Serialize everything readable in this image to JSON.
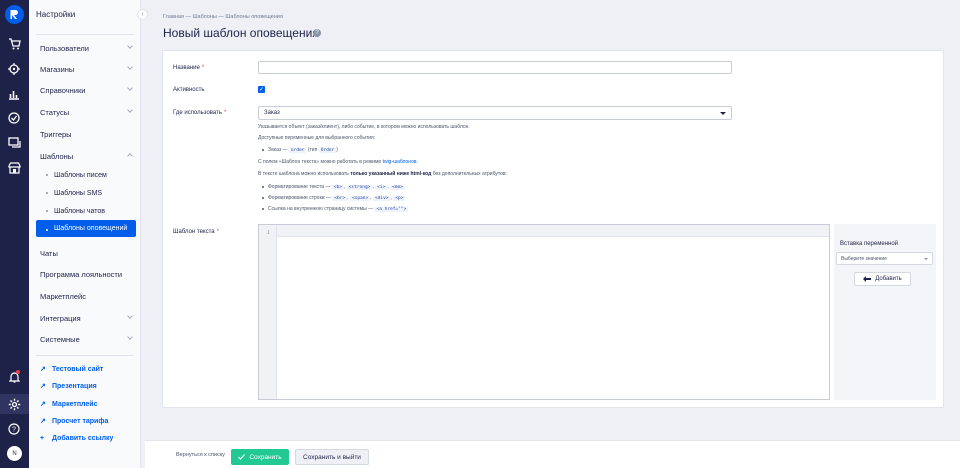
{
  "app": {
    "logo": "retailcrm-logo",
    "rail_icons": [
      "cart-icon",
      "target-icon",
      "analytics-icon",
      "tasks-icon",
      "chat-icon",
      "store-icon",
      "bell-icon",
      "gear-icon",
      "help-icon"
    ],
    "avatar_initial": "N",
    "accent": "#005eeb"
  },
  "sidebar": {
    "title": "Настройки",
    "items": [
      {
        "label": "Пользователи",
        "chevron": true
      },
      {
        "label": "Магазины",
        "chevron": true
      },
      {
        "label": "Справочники",
        "chevron": true
      },
      {
        "label": "Статусы",
        "chevron": true
      },
      {
        "label": "Триггеры",
        "chevron": false
      },
      {
        "label": "Шаблоны",
        "chevron": true,
        "expanded": true
      },
      {
        "label": "Шаблоны писем",
        "sub": true
      },
      {
        "label": "Шаблоны SMS",
        "sub": true
      },
      {
        "label": "Шаблоны чатов",
        "sub": true
      },
      {
        "label": "Шаблоны оповещений",
        "sub": true,
        "active": true
      },
      {
        "label": "Чаты",
        "chevron": false
      },
      {
        "label": "Программа лояльности",
        "chevron": false
      },
      {
        "label": "Маркетплейс",
        "chevron": false
      },
      {
        "label": "Интеграция",
        "chevron": true
      },
      {
        "label": "Системные",
        "chevron": true
      }
    ],
    "links": [
      "Тестовый сайт",
      "Презентация",
      "Маркетплейс",
      "Просчет тарифа"
    ],
    "add_link": "Добавить ссылку"
  },
  "main": {
    "breadcrumb": "Главная — Шаблоны — Шаблоны оповещения",
    "title": "Новый шаблон оповещения",
    "form": {
      "name_label": "Название",
      "name_value": "",
      "active_label": "Активность",
      "active_checked": true,
      "where_label": "Где использовать",
      "where_value": "Заказ",
      "hint1": "Указывается объект (заказ/клиент), либо событие, в котором можно использовать шаблон.",
      "hint2": "Доступные переменные для выбранного события:",
      "hint3_pre": "Заказ —",
      "hint3_code1": "order",
      "hint3_mid": "(тип",
      "hint3_code2": "Order",
      "hint3_post": ")",
      "hint4_pre": "С полем «Шаблон текста» можно работать в режиме",
      "hint4_link": "twig-шаблонов",
      "hint4_post": ".",
      "hint5_pre": "В тексте шаблона можно использовать",
      "hint5_bold": "только указанный ниже html-код",
      "hint5_post": "без дополнительных атрибутов:",
      "fmt_text_label": "Форматирование текста —",
      "fmt_text_tags": [
        "<b>",
        "<strong>",
        "<i>",
        "<em>"
      ],
      "fmt_lines_label": "Форматирование строки —",
      "fmt_lines_tags": [
        "<br>",
        "<span>",
        "<div>",
        "<p>"
      ],
      "link_label": "Ссылка на внутреннюю страницу системы —",
      "link_tag": "<a href=\"\">",
      "template_label": "Шаблон текста",
      "editor_line": "1",
      "var_title": "Вставка переменной",
      "var_placeholder": "Выберите значение",
      "add_button": "Добавить"
    }
  },
  "footer": {
    "back": "Вернуться к списку",
    "save": "Сохранить",
    "save_exit": "Сохранить и выйти",
    "save_color": "#22c993"
  }
}
